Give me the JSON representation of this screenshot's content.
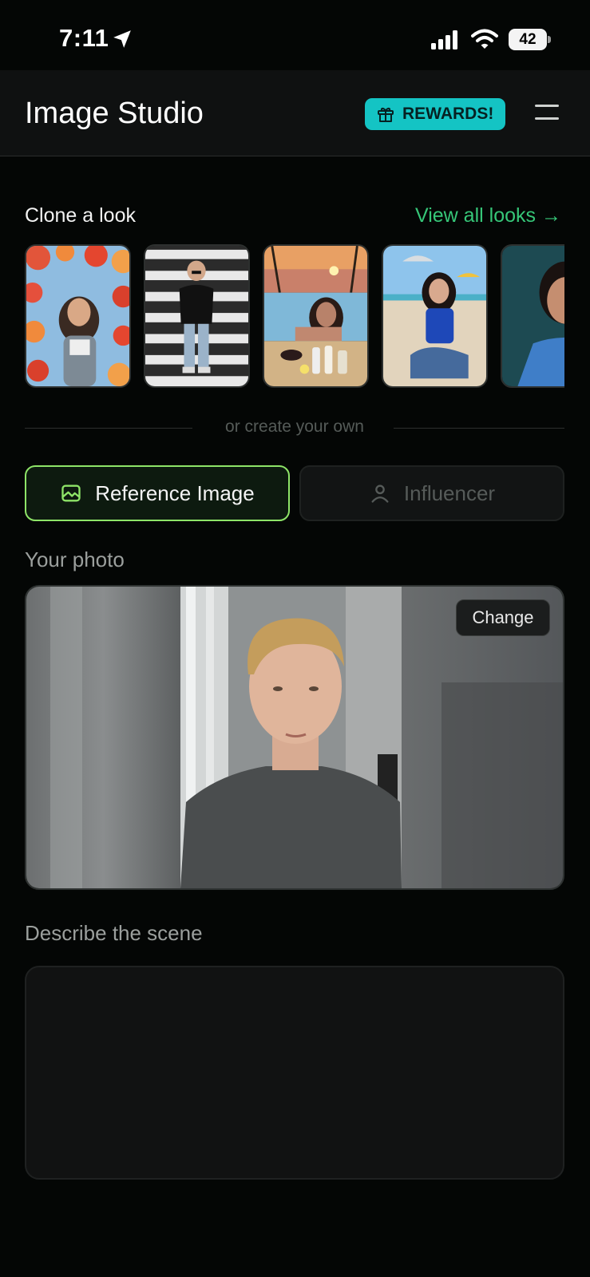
{
  "status_bar": {
    "time": "7:11",
    "battery": "42"
  },
  "header": {
    "title": "Image Studio",
    "rewards_label": "REWARDS!",
    "rewards_icon": "gift-icon",
    "menu_icon": "hamburger-menu-icon"
  },
  "looks_section": {
    "title": "Clone a look",
    "view_all_label": "View all looks →"
  },
  "divider_text": "or create your own",
  "modes": {
    "reference_label": "Reference Image",
    "reference_icon": "image-icon",
    "influencer_label": "Influencer",
    "influencer_icon": "person-icon",
    "selected": "Reference Image"
  },
  "photo_section": {
    "label": "Your photo",
    "change_label": "Change"
  },
  "scene_section": {
    "label": "Describe the scene",
    "value": ""
  },
  "colors": {
    "background": "#040605",
    "accent_green": "#36c678",
    "selected_border": "#8ee468",
    "rewards_bg": "#14c4c4"
  }
}
